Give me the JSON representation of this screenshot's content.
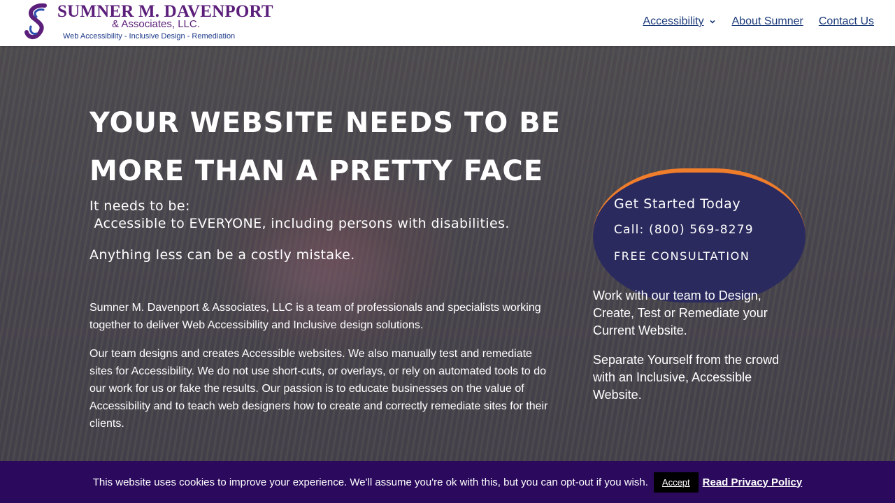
{
  "header": {
    "logo": {
      "name": "SUMNER M. DAVENPORT",
      "sub": "& Associates, LLC.",
      "tagline": "Web Accessibility - Inclusive Design - Remediation"
    },
    "nav": [
      {
        "label": "Accessibility",
        "has_dropdown": true
      },
      {
        "label": "About Sumner"
      },
      {
        "label": "Contact Us"
      }
    ]
  },
  "hero": {
    "headline": "YOUR WEBSITE NEEDS TO BE MORE THAN A PRETTY FACE",
    "needs_intro": "It needs to be:",
    "needs_line": " Accessible to EVERYONE, including persons with disabilities.",
    "costly": "Anything less can be a costly mistake.",
    "para1": "Sumner M. Davenport & Associates, LLC is a team of professionals and specialists working together to deliver Web Accessibility and Inclusive design solutions.",
    "para2": "Our team designs and creates Accessible websites. We also manually test and remediate sites for Accessibility. We do not use short-cuts, or overlays, or rely on automated tools to do our work for us or fake the results. Our passion is to educate businesses on the value of Accessibility and to teach web designers how to create and correctly remediate sites for their clients."
  },
  "cta": {
    "title": "Get Started Today",
    "phone": "Call: (800) 569-8279",
    "free": "FREE CONSULTATION",
    "bg_color": "#2a2a5e",
    "accent_color": "#ef7d2b"
  },
  "side": {
    "text1": "Work with our team to Design, Create, Test or Remediate your Current Website.",
    "text2": "Separate Yourself from the crowd with an Inclusive, Accessible Website."
  },
  "cookie": {
    "text": "This website uses cookies to improve your experience. We'll assume you're ok with this, but you can opt-out if you wish.",
    "accept_label": "Accept",
    "policy_label": "Read Privacy Policy",
    "bg_color": "#2b0a5e"
  },
  "colors": {
    "brand_purple": "#5b1e7a",
    "nav_blue": "#1b3a7a"
  }
}
